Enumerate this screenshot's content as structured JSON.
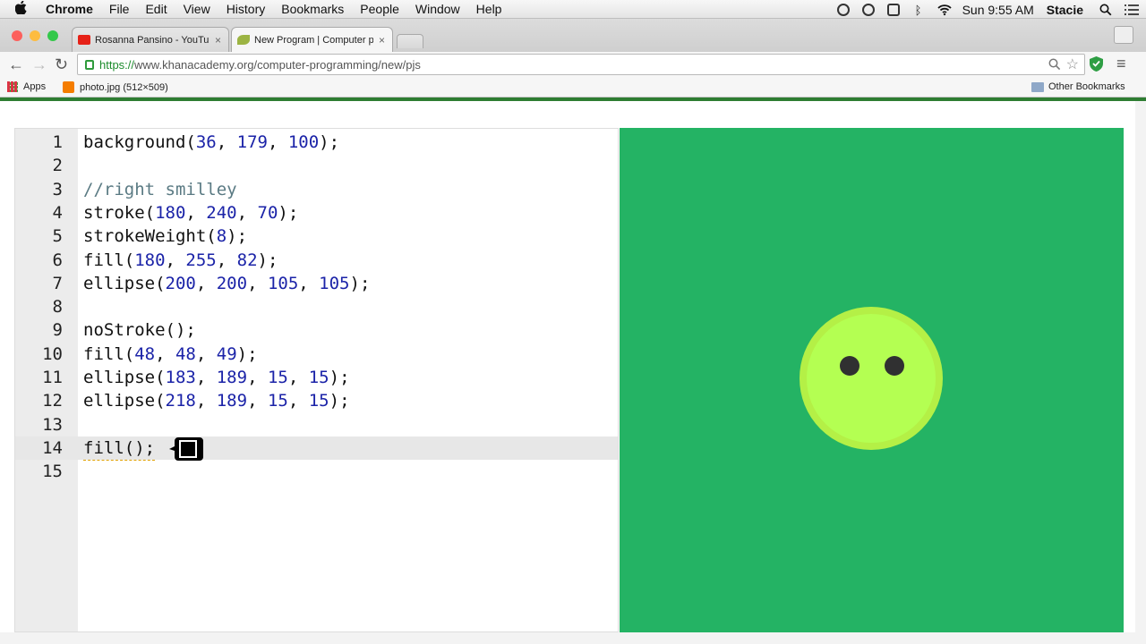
{
  "menubar": {
    "apple": "",
    "items": [
      "Chrome",
      "File",
      "Edit",
      "View",
      "History",
      "Bookmarks",
      "People",
      "Window",
      "Help"
    ],
    "clock": "Sun 9:55 AM",
    "user": "Stacie"
  },
  "tabs": [
    {
      "title": "Rosanna Pansino - YouTub",
      "close": "×",
      "favicon": "youtube-icon"
    },
    {
      "title": "New Program | Computer p",
      "close": "×",
      "favicon": "khan-leaf-icon"
    }
  ],
  "toolbar": {
    "back": "←",
    "forward": "→",
    "reload": "↻",
    "url_scheme": "https://",
    "url_rest": "www.khanacademy.org/computer-programming/new/pjs",
    "menu": "≡"
  },
  "bookmarks": {
    "apps": "Apps",
    "item": "photo.jpg (512×509)",
    "other": "Other Bookmarks"
  },
  "editor": {
    "lines": [
      {
        "n": "1",
        "code": "background(36, 179, 100);"
      },
      {
        "n": "2",
        "code": ""
      },
      {
        "n": "3",
        "code": "//right smilley"
      },
      {
        "n": "4",
        "code": "stroke(180, 240, 70);"
      },
      {
        "n": "5",
        "code": "strokeWeight(8);"
      },
      {
        "n": "6",
        "code": "fill(180, 255, 82);"
      },
      {
        "n": "7",
        "code": "ellipse(200, 200, 105, 105);"
      },
      {
        "n": "8",
        "code": ""
      },
      {
        "n": "9",
        "code": "noStroke();"
      },
      {
        "n": "10",
        "code": "fill(48, 48, 49);"
      },
      {
        "n": "11",
        "code": "ellipse(183, 189, 15, 15);"
      },
      {
        "n": "12",
        "code": "ellipse(218, 189, 15, 15);"
      },
      {
        "n": "13",
        "code": ""
      },
      {
        "n": "14",
        "code": "fill();"
      },
      {
        "n": "15",
        "code": ""
      }
    ],
    "active_line": "14"
  },
  "colors": {
    "canvas_bg": "#24b364",
    "face_fill": "#b4ff52",
    "face_stroke": "#b4f046",
    "eye_fill": "#303031"
  }
}
